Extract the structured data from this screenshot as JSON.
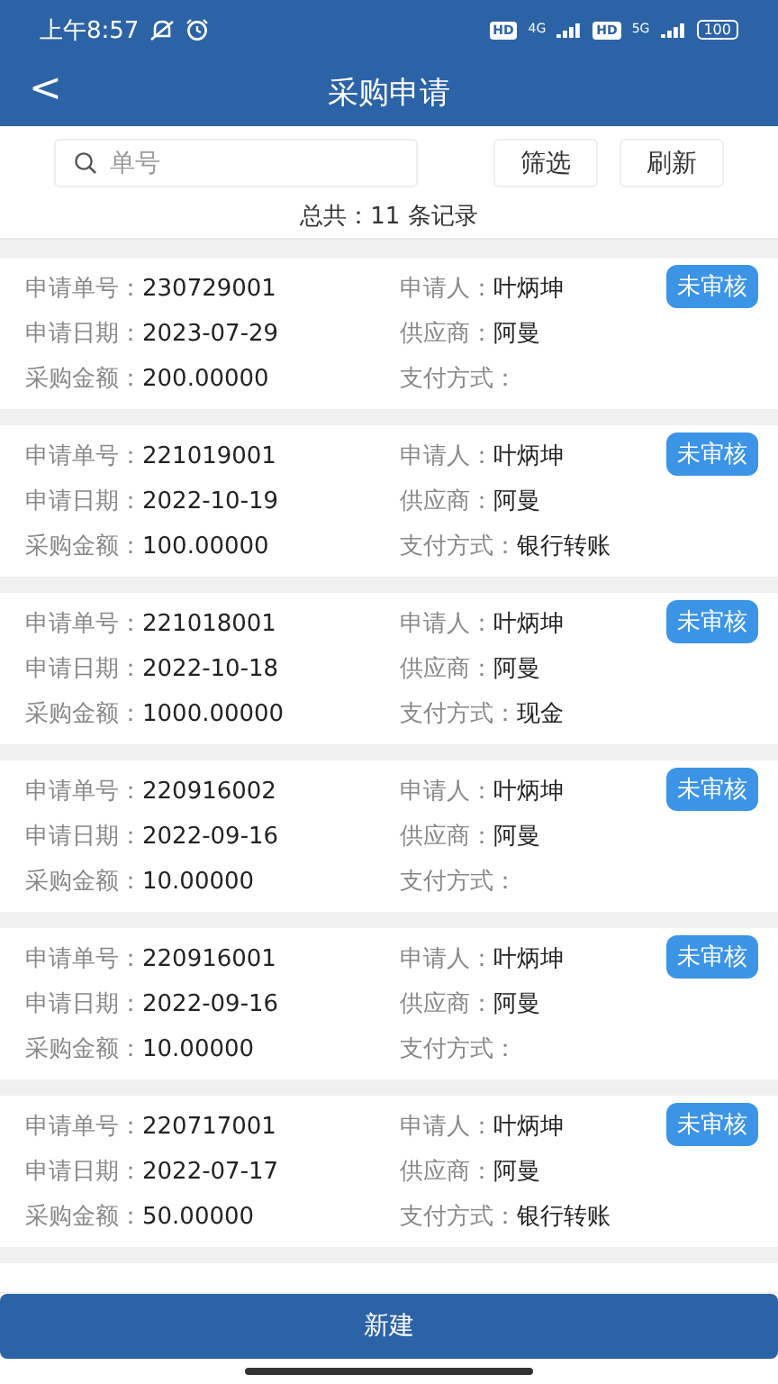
{
  "status_bar": {
    "time": "上午8:57",
    "network": [
      {
        "badge": "HD",
        "type": "4G"
      },
      {
        "badge": "HD",
        "type": "5G"
      }
    ],
    "battery": "100"
  },
  "header": {
    "back": "<",
    "title": "采购申请"
  },
  "toolbar": {
    "search": {
      "placeholder": "单号"
    },
    "buttons": [
      "筛选",
      "刷新"
    ]
  },
  "summary": "总共：11 条记录",
  "records": [
    {
      "fields": [
        {
          "label": "申请单号：",
          "value": "230729001"
        },
        {
          "label": "申请人：",
          "value": "叶炳坤"
        },
        {
          "label": "申请日期：",
          "value": "2023-07-29"
        },
        {
          "label": "供应商：",
          "value": "阿曼"
        },
        {
          "label": "采购金额：",
          "value": "200.00000"
        },
        {
          "label": "支付方式："
        }
      ],
      "status": "未审核"
    },
    {
      "fields": [
        {
          "label": "申请单号：",
          "value": "221019001"
        },
        {
          "label": "申请人：",
          "value": "叶炳坤"
        },
        {
          "label": "申请日期：",
          "value": "2022-10-19"
        },
        {
          "label": "供应商：",
          "value": "阿曼"
        },
        {
          "label": "采购金额：",
          "value": "100.00000"
        },
        {
          "label": "支付方式：",
          "value": "银行转账"
        }
      ],
      "status": "未审核"
    },
    {
      "fields": [
        {
          "label": "申请单号：",
          "value": "221018001"
        },
        {
          "label": "申请人：",
          "value": "叶炳坤"
        },
        {
          "label": "申请日期：",
          "value": "2022-10-18"
        },
        {
          "label": "供应商：",
          "value": "阿曼"
        },
        {
          "label": "采购金额：",
          "value": "1000.00000"
        },
        {
          "label": "支付方式：",
          "value": "现金"
        }
      ],
      "status": "未审核"
    },
    {
      "fields": [
        {
          "label": "申请单号：",
          "value": "220916002"
        },
        {
          "label": "申请人：",
          "value": "叶炳坤"
        },
        {
          "label": "申请日期：",
          "value": "2022-09-16"
        },
        {
          "label": "供应商：",
          "value": "阿曼"
        },
        {
          "label": "采购金额：",
          "value": "10.00000"
        },
        {
          "label": "支付方式："
        }
      ],
      "status": "未审核"
    },
    {
      "fields": [
        {
          "label": "申请单号：",
          "value": "220916001"
        },
        {
          "label": "申请人：",
          "value": "叶炳坤"
        },
        {
          "label": "申请日期：",
          "value": "2022-09-16"
        },
        {
          "label": "供应商：",
          "value": "阿曼"
        },
        {
          "label": "采购金额：",
          "value": "10.00000"
        },
        {
          "label": "支付方式："
        }
      ],
      "status": "未审核"
    },
    {
      "fields": [
        {
          "label": "申请单号：",
          "value": "220717001"
        },
        {
          "label": "申请人：",
          "value": "叶炳坤"
        },
        {
          "label": "申请日期：",
          "value": "2022-07-17"
        },
        {
          "label": "供应商：",
          "value": "阿曼"
        },
        {
          "label": "采购金额：",
          "value": "50.00000"
        },
        {
          "label": "支付方式：",
          "value": "银行转账"
        }
      ],
      "status": "未审核"
    }
  ],
  "primary_button": "新建"
}
